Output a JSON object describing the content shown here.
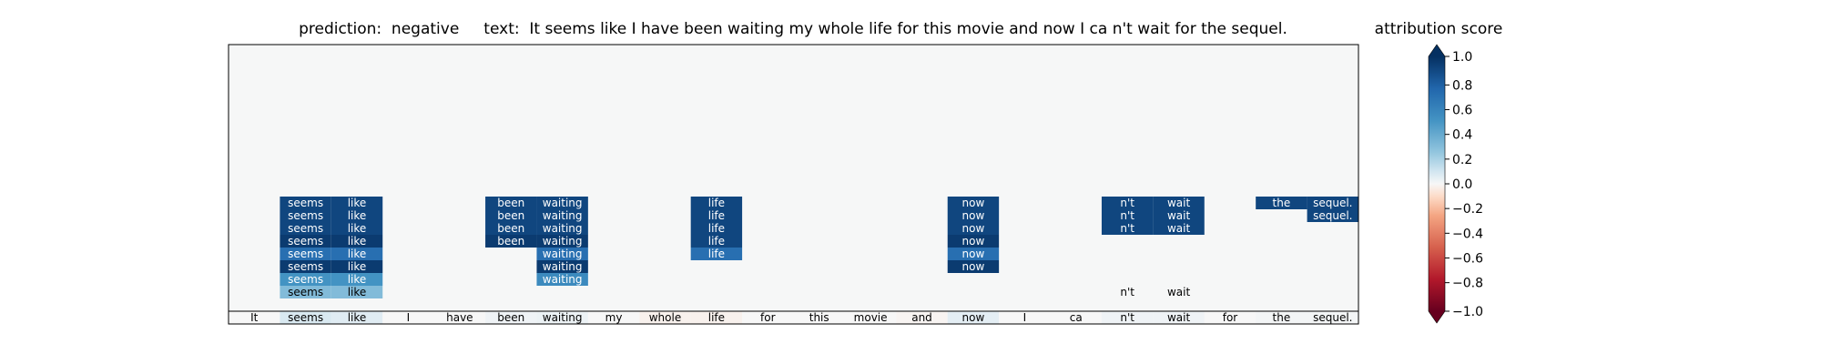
{
  "chart_data": {
    "type": "heatmap",
    "title": "prediction:  negative     text:  It seems like I have been waiting my whole life for this movie and now I ca n't wait for the sequel.",
    "prediction": "negative",
    "tokens": [
      "It",
      "seems",
      "like",
      "I",
      "have",
      "been",
      "waiting",
      "my",
      "whole",
      "life",
      "for",
      "this",
      "movie",
      "and",
      "now",
      "I",
      "ca",
      "n't",
      "wait",
      "for",
      "the",
      "sequel."
    ],
    "token_attributions": [
      0.0,
      0.08,
      0.06,
      0.0,
      0.0,
      0.02,
      0.03,
      0.0,
      -0.02,
      -0.02,
      0.0,
      0.0,
      0.0,
      -0.01,
      0.05,
      0.0,
      0.0,
      0.02,
      0.02,
      0.0,
      0.01,
      0.01
    ],
    "rows": [
      {
        "tokens": [
          {
            "i": 1,
            "t": "seems",
            "v": 0.9
          },
          {
            "i": 2,
            "t": "like",
            "v": 0.9
          },
          {
            "i": 5,
            "t": "been",
            "v": 0.9
          },
          {
            "i": 6,
            "t": "waiting",
            "v": 0.9
          },
          {
            "i": 9,
            "t": "life",
            "v": 0.9
          },
          {
            "i": 14,
            "t": "now",
            "v": 0.9
          },
          {
            "i": 17,
            "t": "n't",
            "v": 0.9
          },
          {
            "i": 18,
            "t": "wait",
            "v": 0.9
          },
          {
            "i": 20,
            "t": "the",
            "v": 0.9
          },
          {
            "i": 21,
            "t": "sequel.",
            "v": 0.9
          }
        ]
      },
      {
        "tokens": [
          {
            "i": 1,
            "t": "seems",
            "v": 0.9
          },
          {
            "i": 2,
            "t": "like",
            "v": 0.9
          },
          {
            "i": 5,
            "t": "been",
            "v": 0.9
          },
          {
            "i": 6,
            "t": "waiting",
            "v": 0.9
          },
          {
            "i": 9,
            "t": "life",
            "v": 0.9
          },
          {
            "i": 14,
            "t": "now",
            "v": 0.9
          },
          {
            "i": 17,
            "t": "n't",
            "v": 0.9
          },
          {
            "i": 18,
            "t": "wait",
            "v": 0.9
          },
          {
            "i": 21,
            "t": "sequel.",
            "v": 0.9
          }
        ]
      },
      {
        "tokens": [
          {
            "i": 1,
            "t": "seems",
            "v": 0.9
          },
          {
            "i": 2,
            "t": "like",
            "v": 0.9
          },
          {
            "i": 5,
            "t": "been",
            "v": 0.9
          },
          {
            "i": 6,
            "t": "waiting",
            "v": 0.9
          },
          {
            "i": 9,
            "t": "life",
            "v": 0.9
          },
          {
            "i": 14,
            "t": "now",
            "v": 0.9
          },
          {
            "i": 17,
            "t": "n't",
            "v": 0.9
          },
          {
            "i": 18,
            "t": "wait",
            "v": 0.9
          }
        ]
      },
      {
        "tokens": [
          {
            "i": 1,
            "t": "seems",
            "v": 0.95
          },
          {
            "i": 2,
            "t": "like",
            "v": 0.95
          },
          {
            "i": 5,
            "t": "been",
            "v": 0.95
          },
          {
            "i": 6,
            "t": "waiting",
            "v": 0.95
          },
          {
            "i": 9,
            "t": "life",
            "v": 0.9
          },
          {
            "i": 14,
            "t": "now",
            "v": 0.95
          }
        ]
      },
      {
        "tokens": [
          {
            "i": 1,
            "t": "seems",
            "v": 0.7
          },
          {
            "i": 2,
            "t": "like",
            "v": 0.7
          },
          {
            "i": 6,
            "t": "waiting",
            "v": 0.7
          },
          {
            "i": 9,
            "t": "life",
            "v": 0.7
          },
          {
            "i": 14,
            "t": "now",
            "v": 0.7
          }
        ]
      },
      {
        "tokens": [
          {
            "i": 1,
            "t": "seems",
            "v": 0.95
          },
          {
            "i": 2,
            "t": "like",
            "v": 0.95
          },
          {
            "i": 6,
            "t": "waiting",
            "v": 0.95
          },
          {
            "i": 14,
            "t": "now",
            "v": 0.95
          }
        ]
      },
      {
        "tokens": [
          {
            "i": 1,
            "t": "seems",
            "v": 0.5
          },
          {
            "i": 2,
            "t": "like",
            "v": 0.5
          },
          {
            "i": 6,
            "t": "waiting",
            "v": 0.55
          }
        ]
      },
      {
        "tokens": [
          {
            "i": 1,
            "t": "seems",
            "v": 0.3
          },
          {
            "i": 2,
            "t": "like",
            "v": 0.3
          },
          {
            "i": 17,
            "t": "n't",
            "v": 0.0
          },
          {
            "i": 18,
            "t": "wait",
            "v": 0.0
          }
        ]
      }
    ],
    "colorbar": {
      "title": "attribution score",
      "range": [
        -1.0,
        1.0
      ],
      "ticks": [
        -1.0,
        -0.8,
        -0.6,
        -0.4,
        -0.2,
        0.0,
        0.2,
        0.4,
        0.6,
        0.8,
        1.0
      ],
      "tick_labels": [
        "−1.0",
        "−0.8",
        "−0.6",
        "−0.4",
        "−0.2",
        "0.0",
        "0.2",
        "0.4",
        "0.6",
        "0.8",
        "1.0"
      ],
      "colormap": "RdBu",
      "extend": "both"
    },
    "background_color": "#f6f7f7"
  }
}
